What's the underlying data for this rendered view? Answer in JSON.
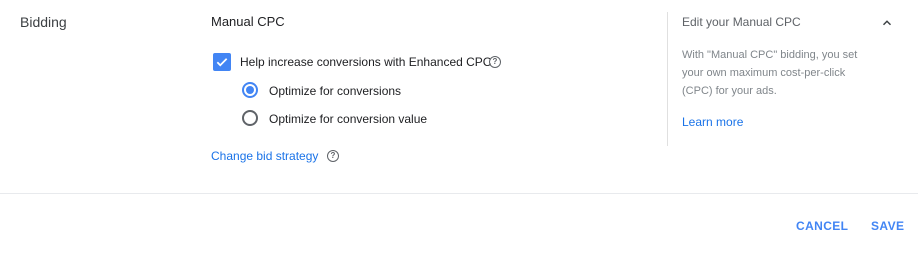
{
  "section": {
    "label": "Bidding",
    "strategy": "Manual CPC"
  },
  "enhanced_cpc": {
    "checked": true,
    "label": "Help increase conversions with Enhanced CPC"
  },
  "optimize_options": [
    {
      "label": "Optimize for conversions",
      "selected": true
    },
    {
      "label": "Optimize for conversion value",
      "selected": false
    }
  ],
  "change_bid_strategy": "Change bid strategy",
  "help_panel": {
    "title": "Edit your Manual CPC",
    "text": "With \"Manual CPC\" bidding, you set your own maximum cost-per-click (CPC) for your ads.",
    "learn_more": "Learn more"
  },
  "footer": {
    "cancel": "CANCEL",
    "save": "SAVE"
  },
  "colors": {
    "accent": "#4285f4",
    "link": "#1a73e8"
  },
  "icons": {
    "checkbox": "check-icon",
    "help": "help-circle-icon",
    "collapse": "chevron-up-icon"
  }
}
